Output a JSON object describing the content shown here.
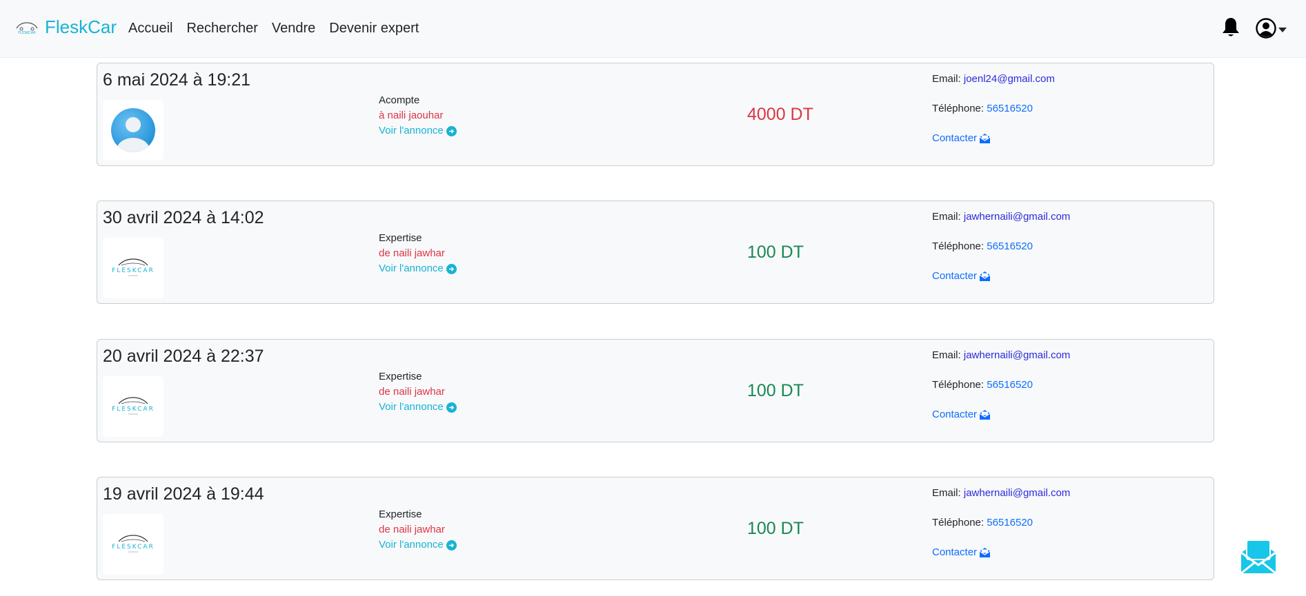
{
  "brand": {
    "name": "FleskCar",
    "logo_text": "FLESKCAR",
    "logo_icon": "car-logo-icon"
  },
  "nav": {
    "links": [
      "Accueil",
      "Rechercher",
      "Vendre",
      "Devenir expert"
    ]
  },
  "header_icons": {
    "bell": "bell-icon",
    "user": "user-circle-icon"
  },
  "colors": {
    "accent": "#17b3d4",
    "negative": "#dc3545",
    "positive": "#198754",
    "link": "#0d6efd"
  },
  "labels": {
    "email": "Email:",
    "telephone": "Téléphone:",
    "contacter": "Contacter",
    "voir": "Voir l'annonce"
  },
  "transactions": [
    {
      "date": "6 mai 2024 à 19:21",
      "type": "Acompte",
      "party": "à naili jaouhar",
      "amount": "4000 DT",
      "amount_color": "red",
      "thumb": "user-avatar",
      "email": "joenl24@gmail.com",
      "phone": "56516520"
    },
    {
      "date": "30 avril 2024 à 14:02",
      "type": "Expertise",
      "party": "de naili jawhar",
      "amount": "100 DT",
      "amount_color": "green",
      "thumb": "fleskcar-logo",
      "email": "jawhernaili@gmail.com",
      "phone": "56516520"
    },
    {
      "date": "20 avril 2024 à 22:37",
      "type": "Expertise",
      "party": "de naili jawhar",
      "amount": "100 DT",
      "amount_color": "green",
      "thumb": "fleskcar-logo",
      "email": "jawhernaili@gmail.com",
      "phone": "56516520"
    },
    {
      "date": "19 avril 2024 à 19:44",
      "type": "Expertise",
      "party": "de naili jawhar",
      "amount": "100 DT",
      "amount_color": "green",
      "thumb": "fleskcar-logo",
      "email": "jawhernaili@gmail.com",
      "phone": "56516520"
    }
  ],
  "fab": {
    "icon": "envelope-open-icon"
  }
}
